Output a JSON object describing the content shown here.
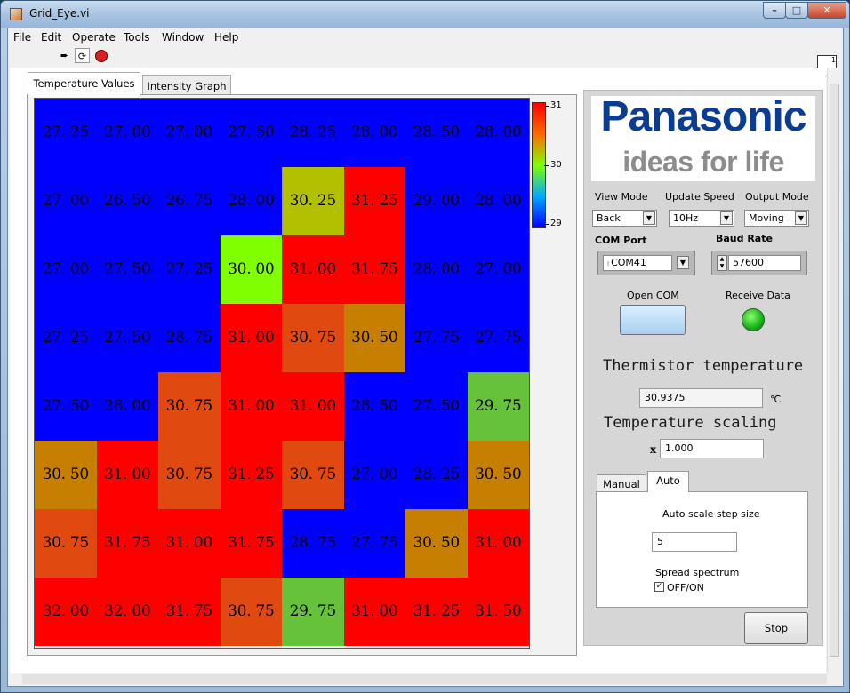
{
  "window": {
    "title": "Grid_Eye.vi"
  },
  "menu": {
    "file": "File",
    "edit": "Edit",
    "operate": "Operate",
    "tools": "Tools",
    "window": "Window",
    "help": "Help"
  },
  "tabs": {
    "temperature_values": "Temperature Values",
    "intensity_graph": "Intensity Graph"
  },
  "colorbar": {
    "max": "31",
    "mid": "30",
    "min": "29"
  },
  "grid": [
    [
      "27. 25",
      "27. 00",
      "27. 00",
      "27. 50",
      "28. 25",
      "28. 00",
      "28. 50",
      "28. 00"
    ],
    [
      "27. 00",
      "26. 50",
      "26. 75",
      "28. 00",
      "30. 25",
      "31. 25",
      "29. 00",
      "28. 00"
    ],
    [
      "27. 00",
      "27. 50",
      "27. 25",
      "30. 00",
      "31. 00",
      "31. 75",
      "28. 00",
      "27. 00"
    ],
    [
      "27. 25",
      "27. 50",
      "28. 75",
      "31. 00",
      "30. 75",
      "30. 50",
      "27. 75",
      "27. 75"
    ],
    [
      "27. 50",
      "28. 00",
      "30. 75",
      "31. 00",
      "31. 00",
      "28. 50",
      "27. 50",
      "29. 75"
    ],
    [
      "30. 50",
      "31. 00",
      "30. 75",
      "31. 25",
      "30. 75",
      "27. 00",
      "28. 25",
      "30. 50"
    ],
    [
      "30. 75",
      "31. 75",
      "31. 00",
      "31. 75",
      "28. 75",
      "27. 75",
      "30. 50",
      "31. 00"
    ],
    [
      "32. 00",
      "32. 00",
      "31. 75",
      "30. 75",
      "29. 75",
      "31. 00",
      "31. 25",
      "31. 50"
    ]
  ],
  "colors": {
    "blue": "#0000ff",
    "red": "#ff0000",
    "green": "#66c23a",
    "lime": "#80ff00",
    "olive": "#b3c000",
    "orange": "#c67f00",
    "redorange": "#e04a10"
  },
  "logo": {
    "brand": "Panasonic",
    "tagline": "ideas for life"
  },
  "controls": {
    "view_mode_label": "View Mode",
    "view_mode_value": "Back",
    "update_speed_label": "Update Speed",
    "update_speed_value": "10Hz",
    "output_mode_label": "Output Mode",
    "output_mode_value": "Moving",
    "com_port_label": "COM Port",
    "com_port_value": "COM41",
    "baud_rate_label": "Baud Rate",
    "baud_rate_value": "57600",
    "open_com_label": "Open COM",
    "receive_data_label": "Receive Data",
    "thermistor_label": "Thermistor temperature",
    "thermistor_value": "30.9375",
    "thermistor_unit": "℃",
    "scaling_label": "Temperature scaling",
    "scaling_prefix": "x",
    "scaling_value": "1.000",
    "tab_manual": "Manual",
    "tab_auto": "Auto",
    "auto_step_label": "Auto scale step size",
    "auto_step_value": "5",
    "spread_label": "Spread spectrum",
    "spread_toggle": "OFF/ON",
    "stop_label": "Stop"
  }
}
